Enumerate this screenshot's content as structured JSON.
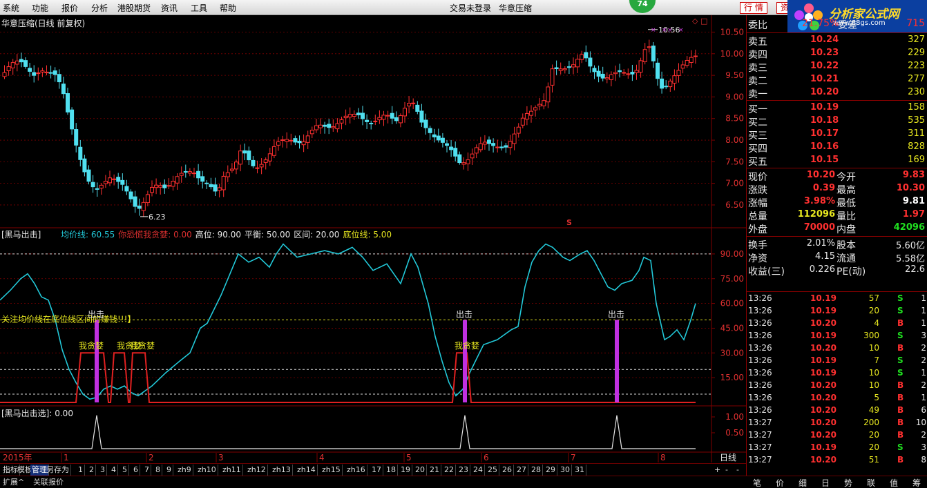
{
  "menubar": {
    "items": [
      "系统",
      "功能",
      "报价",
      "分析",
      "港股期货",
      "资讯",
      "工具",
      "帮助"
    ],
    "center": [
      "交易未登录",
      "华意压缩"
    ],
    "badge": "74",
    "buttons": [
      "行 情",
      "资"
    ]
  },
  "logo": {
    "name": "分析家公式网",
    "url": "www.88gs.com"
  },
  "main_chart": {
    "title": "华意压缩(日线 前复权)",
    "y_labels": [
      "10.50",
      "10.00",
      "9.50",
      "9.00",
      "8.50",
      "8.00",
      "7.50",
      "7.00",
      "6.50"
    ],
    "low_label": "6.23",
    "high_label": "10.56",
    "s_marker": "S",
    "corner_icons": [
      "◇",
      "□"
    ]
  },
  "indicator": {
    "name": "[黑马出击]",
    "legend": [
      {
        "text": "均价线: 60.55",
        "color": "#22c8d8"
      },
      {
        "text": "你恐慌我贪婪: 0.00",
        "color": "#e03030"
      },
      {
        "text": "高位: 90.00",
        "color": "#e8e8e8"
      },
      {
        "text": "平衡: 50.00",
        "color": "#e8e8e8"
      },
      {
        "text": "区间: 20.00",
        "color": "#e8e8e8"
      },
      {
        "text": "底位线: 5.00",
        "color": "#e8e820"
      }
    ],
    "y_labels": [
      "90.00",
      "75.00",
      "60.00",
      "45.00",
      "30.00",
      "15.00"
    ],
    "note": "关注均价线在底位线区间的赚钱!!!】",
    "hit_label": "出击",
    "greed_label": "我贪婪"
  },
  "sub_indicator": {
    "name": "[黑马出击选]",
    "value": ": 0.00",
    "y_labels": [
      "1.00",
      "0.50"
    ]
  },
  "x_axis": {
    "year": "2015年",
    "months": [
      "1",
      "2",
      "3",
      "4",
      "5",
      "6",
      "7",
      "8"
    ],
    "period": "日线"
  },
  "bottom_tabs": [
    "指标",
    "模板",
    "管理",
    "另存为",
    "1",
    "2",
    "3",
    "4",
    "5",
    "6",
    "7",
    "8",
    "9",
    "zh9",
    "zh10",
    "zh11",
    "zh12",
    "zh13",
    "zh14",
    "zh15",
    "zh16",
    "17",
    "18",
    "19",
    "20",
    "21",
    "22",
    "23",
    "24",
    "25",
    "26",
    "27",
    "28",
    "29",
    "30",
    "31"
  ],
  "bottom_controls": [
    "+",
    "-",
    "-"
  ],
  "status_tabs": [
    "扩展^",
    "关联报价"
  ],
  "quote": {
    "ratio": {
      "l1": "委比",
      "v1": "21.75%",
      "l2": "委差",
      "v2": "715"
    },
    "sells": [
      {
        "label": "卖五",
        "price": "10.24",
        "vol": "327"
      },
      {
        "label": "卖四",
        "price": "10.23",
        "vol": "229"
      },
      {
        "label": "卖三",
        "price": "10.22",
        "vol": "223"
      },
      {
        "label": "卖二",
        "price": "10.21",
        "vol": "277"
      },
      {
        "label": "卖一",
        "price": "10.20",
        "vol": "230"
      }
    ],
    "buys": [
      {
        "label": "买一",
        "price": "10.19",
        "vol": "158"
      },
      {
        "label": "买二",
        "price": "10.18",
        "vol": "535"
      },
      {
        "label": "买三",
        "price": "10.17",
        "vol": "311"
      },
      {
        "label": "买四",
        "price": "10.16",
        "vol": "828"
      },
      {
        "label": "买五",
        "price": "10.15",
        "vol": "169"
      }
    ],
    "stats": [
      {
        "l1": "现价",
        "v1": "10.20",
        "c1": "#ff3030",
        "l2": "今开",
        "v2": "9.83",
        "c2": "#ff3030"
      },
      {
        "l1": "涨跌",
        "v1": "0.39",
        "c1": "#ff3030",
        "l2": "最高",
        "v2": "10.30",
        "c2": "#ff3030"
      },
      {
        "l1": "涨幅",
        "v1": "3.98%",
        "c1": "#ff3030",
        "l2": "最低",
        "v2": "9.81",
        "c2": "#ffffff"
      },
      {
        "l1": "总量",
        "v1": "112096",
        "c1": "#e8e820",
        "l2": "量比",
        "v2": "1.97",
        "c2": "#ff3030"
      },
      {
        "l1": "外盘",
        "v1": "70000",
        "c1": "#ff3030",
        "l2": "内盘",
        "v2": "42096",
        "c2": "#20e020"
      }
    ],
    "fund": [
      {
        "l1": "换手",
        "v1": "2.01%",
        "l2": "股本",
        "v2": "5.60亿"
      },
      {
        "l1": "净资",
        "v1": "4.15",
        "l2": "流通",
        "v2": "5.58亿"
      },
      {
        "l1": "收益(三)",
        "v1": "0.226",
        "l2": "PE(动)",
        "v2": "22.6"
      }
    ],
    "ticks": [
      {
        "t": "13:26",
        "p": "10.19",
        "v": "57",
        "s": "S",
        "n": "1"
      },
      {
        "t": "13:26",
        "p": "10.19",
        "v": "20",
        "s": "S",
        "n": "1"
      },
      {
        "t": "13:26",
        "p": "10.20",
        "v": "4",
        "s": "B",
        "n": "1"
      },
      {
        "t": "13:26",
        "p": "10.19",
        "v": "300",
        "s": "S",
        "n": "3"
      },
      {
        "t": "13:26",
        "p": "10.20",
        "v": "10",
        "s": "B",
        "n": "2"
      },
      {
        "t": "13:26",
        "p": "10.19",
        "v": "7",
        "s": "S",
        "n": "2"
      },
      {
        "t": "13:26",
        "p": "10.19",
        "v": "10",
        "s": "S",
        "n": "1"
      },
      {
        "t": "13:26",
        "p": "10.20",
        "v": "10",
        "s": "B",
        "n": "2"
      },
      {
        "t": "13:26",
        "p": "10.20",
        "v": "5",
        "s": "B",
        "n": "1"
      },
      {
        "t": "13:26",
        "p": "10.20",
        "v": "49",
        "s": "B",
        "n": "6"
      },
      {
        "t": "13:27",
        "p": "10.20",
        "v": "200",
        "s": "B",
        "n": "10"
      },
      {
        "t": "13:27",
        "p": "10.20",
        "v": "20",
        "s": "B",
        "n": "2"
      },
      {
        "t": "13:27",
        "p": "10.19",
        "v": "20",
        "s": "S",
        "n": "3"
      },
      {
        "t": "13:27",
        "p": "10.20",
        "v": "51",
        "s": "B",
        "n": "8"
      }
    ],
    "bottom_tabs": [
      "笔",
      "价",
      "细",
      "日",
      "势",
      "联",
      "值",
      "筹"
    ]
  },
  "colors": {
    "up": "#ff3030",
    "down": "#50e0f0",
    "avg": "#22c8d8",
    "purple": "#c030e0",
    "grid": "#800000"
  }
}
